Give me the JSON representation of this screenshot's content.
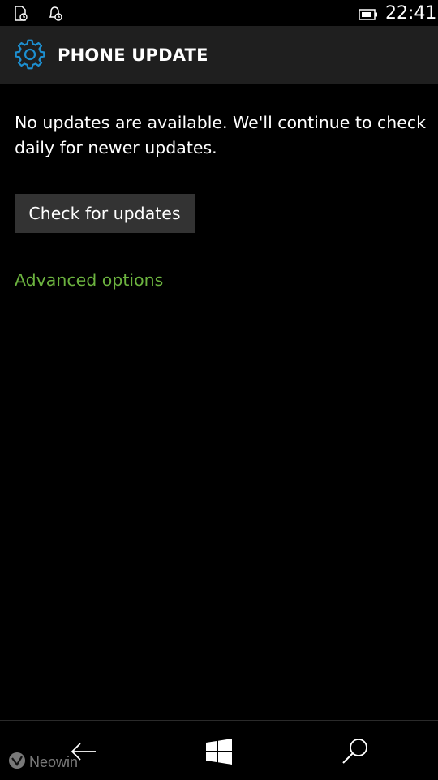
{
  "status_bar": {
    "time": "22:41",
    "icons": [
      "document-clock-icon",
      "bell-clock-icon",
      "battery-icon"
    ]
  },
  "header": {
    "icon": "gear-icon",
    "title": "PHONE UPDATE"
  },
  "main": {
    "message": "No updates are available. We'll continue to check daily for newer updates.",
    "check_button_label": "Check for updates",
    "advanced_link_label": "Advanced options"
  },
  "nav_bar": {
    "buttons": [
      "back-arrow-icon",
      "windows-logo-icon",
      "search-icon"
    ]
  },
  "watermark": {
    "text": "Neowin"
  },
  "colors": {
    "background": "#000000",
    "header": "#1f1f1f",
    "accent": "#1d8fd0",
    "link": "#6cb33f",
    "button": "#333333"
  }
}
